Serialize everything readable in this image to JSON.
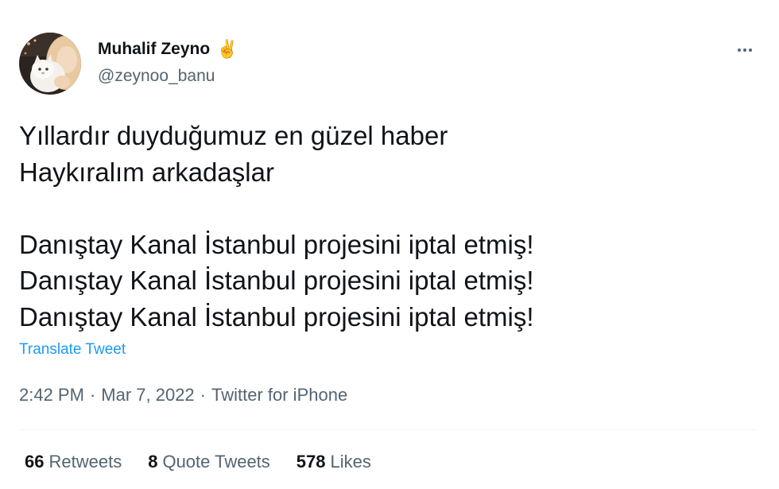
{
  "author": {
    "display_name": "Muhalif Zeyno",
    "emoji": "✌️",
    "handle": "@zeynoo_banu"
  },
  "tweet": {
    "lines": [
      "Yıllardır duyduğumuz en güzel haber",
      "Haykıralım arkadaşlar",
      "",
      "Danıştay Kanal İstanbul projesini iptal etmiş!",
      "Danıştay Kanal İstanbul projesini iptal etmiş!",
      "Danıştay Kanal İstanbul projesini iptal etmiş!"
    ],
    "translate_label": "Translate Tweet"
  },
  "meta": {
    "time": "2:42 PM",
    "separator": "·",
    "date": "Mar 7, 2022",
    "source": "Twitter for iPhone"
  },
  "stats": {
    "retweets_count": "66",
    "retweets_label": "Retweets",
    "quotes_count": "8",
    "quotes_label": "Quote Tweets",
    "likes_count": "578",
    "likes_label": "Likes"
  },
  "icons": {
    "more": "more-options-icon",
    "avatar": "avatar-image"
  },
  "colors": {
    "link": "#1d9bf0",
    "secondary_text": "#536471",
    "primary_text": "#0f1419",
    "divider": "#eff3f4"
  }
}
